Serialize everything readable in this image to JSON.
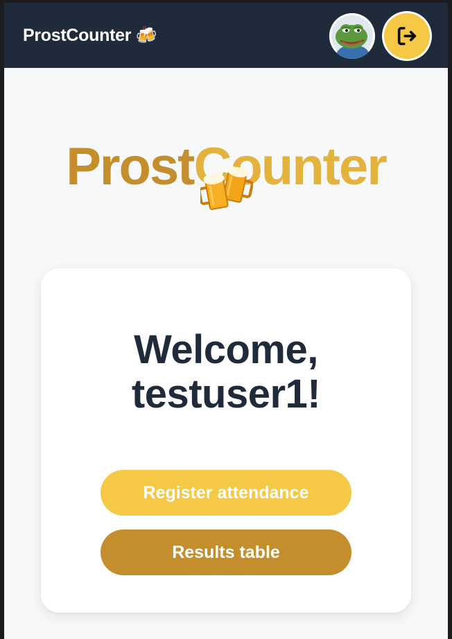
{
  "navbar": {
    "brand": "ProstCounter 🍻",
    "avatar_icon": "frog-avatar-icon",
    "logout_icon": "logout-icon"
  },
  "hero": {
    "title_part1": "Prost",
    "title_part2": "Counter",
    "emoji": "🍻"
  },
  "card": {
    "welcome_line1": "Welcome,",
    "welcome_line2": "testuser1!",
    "register_button": "Register attendance",
    "results_button": "Results table"
  },
  "colors": {
    "navbar_bg": "#1f2a3a",
    "gold_dark": "#c38e2b",
    "gold_light": "#e4b33d",
    "yellow": "#f5c945",
    "text_dark": "#1f2a3a"
  }
}
